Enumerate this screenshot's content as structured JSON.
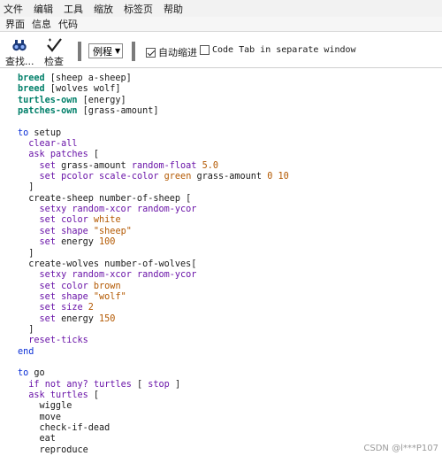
{
  "menubar": {
    "items": [
      "文件",
      "编辑",
      "工具",
      "缩放",
      "标签页",
      "帮助"
    ]
  },
  "tabs": [
    "界面",
    "信息",
    "代码"
  ],
  "toolbar": {
    "find_label": "查找...",
    "check_label": "检查",
    "procedures_label": "例程",
    "auto_indent_label": "自动缩进",
    "auto_indent_checked": true,
    "separate_window_label": "Code Tab in separate window",
    "separate_window_checked": false
  },
  "code_lines": [
    [
      [
        "kw",
        "breed"
      ],
      [
        "pl",
        " [sheep a-sheep]"
      ]
    ],
    [
      [
        "kw",
        "breed"
      ],
      [
        "pl",
        " [wolves wolf]"
      ]
    ],
    [
      [
        "kw",
        "turtles-own"
      ],
      [
        "pl",
        " [energy]"
      ]
    ],
    [
      [
        "kw",
        "patches-own"
      ],
      [
        "pl",
        " [grass-amount]"
      ]
    ],
    [],
    [
      [
        "kw2",
        "to"
      ],
      [
        "pl",
        " setup"
      ]
    ],
    [
      [
        "pl",
        "  "
      ],
      [
        "prim",
        "clear-all"
      ]
    ],
    [
      [
        "pl",
        "  "
      ],
      [
        "prim",
        "ask"
      ],
      [
        "pl",
        " "
      ],
      [
        "prim",
        "patches"
      ],
      [
        "pl",
        " ["
      ]
    ],
    [
      [
        "pl",
        "    "
      ],
      [
        "prim",
        "set"
      ],
      [
        "pl",
        " grass-amount "
      ],
      [
        "prim",
        "random-float"
      ],
      [
        "pl",
        " "
      ],
      [
        "num",
        "5.0"
      ]
    ],
    [
      [
        "pl",
        "    "
      ],
      [
        "prim",
        "set"
      ],
      [
        "pl",
        " "
      ],
      [
        "prim",
        "pcolor"
      ],
      [
        "pl",
        " "
      ],
      [
        "prim",
        "scale-color"
      ],
      [
        "pl",
        " "
      ],
      [
        "num",
        "green"
      ],
      [
        "pl",
        " grass-amount "
      ],
      [
        "num",
        "0"
      ],
      [
        "pl",
        " "
      ],
      [
        "num",
        "10"
      ]
    ],
    [
      [
        "pl",
        "  ]"
      ]
    ],
    [
      [
        "pl",
        "  create-sheep number-of-sheep ["
      ]
    ],
    [
      [
        "pl",
        "    "
      ],
      [
        "prim",
        "setxy"
      ],
      [
        "pl",
        " "
      ],
      [
        "prim",
        "random-xcor"
      ],
      [
        "pl",
        " "
      ],
      [
        "prim",
        "random-ycor"
      ]
    ],
    [
      [
        "pl",
        "    "
      ],
      [
        "prim",
        "set"
      ],
      [
        "pl",
        " "
      ],
      [
        "prim",
        "color"
      ],
      [
        "pl",
        " "
      ],
      [
        "num",
        "white"
      ]
    ],
    [
      [
        "pl",
        "    "
      ],
      [
        "prim",
        "set"
      ],
      [
        "pl",
        " "
      ],
      [
        "prim",
        "shape"
      ],
      [
        "pl",
        " "
      ],
      [
        "str",
        "\"sheep\""
      ]
    ],
    [
      [
        "pl",
        "    "
      ],
      [
        "prim",
        "set"
      ],
      [
        "pl",
        " energy "
      ],
      [
        "num",
        "100"
      ]
    ],
    [
      [
        "pl",
        "  ]"
      ]
    ],
    [
      [
        "pl",
        "  create-wolves number-of-wolves["
      ]
    ],
    [
      [
        "pl",
        "    "
      ],
      [
        "prim",
        "setxy"
      ],
      [
        "pl",
        " "
      ],
      [
        "prim",
        "random-xcor"
      ],
      [
        "pl",
        " "
      ],
      [
        "prim",
        "random-ycor"
      ]
    ],
    [
      [
        "pl",
        "    "
      ],
      [
        "prim",
        "set"
      ],
      [
        "pl",
        " "
      ],
      [
        "prim",
        "color"
      ],
      [
        "pl",
        " "
      ],
      [
        "num",
        "brown"
      ]
    ],
    [
      [
        "pl",
        "    "
      ],
      [
        "prim",
        "set"
      ],
      [
        "pl",
        " "
      ],
      [
        "prim",
        "shape"
      ],
      [
        "pl",
        " "
      ],
      [
        "str",
        "\"wolf\""
      ]
    ],
    [
      [
        "pl",
        "    "
      ],
      [
        "prim",
        "set"
      ],
      [
        "pl",
        " "
      ],
      [
        "prim",
        "size"
      ],
      [
        "pl",
        " "
      ],
      [
        "num",
        "2"
      ]
    ],
    [
      [
        "pl",
        "    "
      ],
      [
        "prim",
        "set"
      ],
      [
        "pl",
        " energy "
      ],
      [
        "num",
        "150"
      ]
    ],
    [
      [
        "pl",
        "  ]"
      ]
    ],
    [
      [
        "pl",
        "  "
      ],
      [
        "prim",
        "reset-ticks"
      ]
    ],
    [
      [
        "kw2",
        "end"
      ]
    ],
    [],
    [
      [
        "kw2",
        "to"
      ],
      [
        "pl",
        " go"
      ]
    ],
    [
      [
        "pl",
        "  "
      ],
      [
        "prim",
        "if"
      ],
      [
        "pl",
        " "
      ],
      [
        "prim",
        "not"
      ],
      [
        "pl",
        " "
      ],
      [
        "prim",
        "any?"
      ],
      [
        "pl",
        " "
      ],
      [
        "prim",
        "turtles"
      ],
      [
        "pl",
        " [ "
      ],
      [
        "prim",
        "stop"
      ],
      [
        "pl",
        " ]"
      ]
    ],
    [
      [
        "pl",
        "  "
      ],
      [
        "prim",
        "ask"
      ],
      [
        "pl",
        " "
      ],
      [
        "prim",
        "turtles"
      ],
      [
        "pl",
        " ["
      ]
    ],
    [
      [
        "pl",
        "    wiggle"
      ]
    ],
    [
      [
        "pl",
        "    move"
      ]
    ],
    [
      [
        "pl",
        "    check-if-dead"
      ]
    ],
    [
      [
        "pl",
        "    eat"
      ]
    ],
    [
      [
        "pl",
        "    reproduce"
      ]
    ]
  ],
  "watermark": "CSDN @l***P107",
  "colors": {
    "keyword": "#007f69",
    "procedure_keyword": "#0b2fd6",
    "primitive": "#6a14a8",
    "constant": "#b35800"
  }
}
